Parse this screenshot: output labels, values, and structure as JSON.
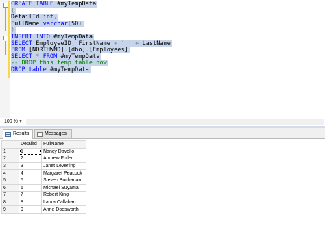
{
  "editor": {
    "lines": [
      [
        {
          "c": "kw",
          "t": "CREATE TABLE "
        },
        {
          "c": "tx",
          "t": "#myTempData"
        }
      ],
      [
        {
          "c": "gr",
          "t": "("
        }
      ],
      [
        {
          "c": "tx",
          "t": "DetailId "
        },
        {
          "c": "kw",
          "t": "int"
        },
        {
          "c": "gr",
          "t": ","
        }
      ],
      [
        {
          "c": "tx",
          "t": "FullName "
        },
        {
          "c": "kw",
          "t": "varchar"
        },
        {
          "c": "gr",
          "t": "("
        },
        {
          "c": "tx",
          "t": "50"
        },
        {
          "c": "gr",
          "t": ")"
        }
      ],
      [
        {
          "c": "gr",
          "t": ")"
        }
      ],
      [
        {
          "c": "kw",
          "t": "INSERT INTO "
        },
        {
          "c": "tx",
          "t": "#myTempData"
        }
      ],
      [
        {
          "c": "kw",
          "t": "SELECT "
        },
        {
          "c": "tx",
          "t": "EmployeeID"
        },
        {
          "c": "gr",
          "t": ", "
        },
        {
          "c": "tx",
          "t": "FirstName "
        },
        {
          "c": "gr",
          "t": "+ "
        },
        {
          "c": "st",
          "t": "' '"
        },
        {
          "c": "gr",
          "t": " + "
        },
        {
          "c": "tx",
          "t": "LastName"
        }
      ],
      [
        {
          "c": "kw",
          "t": "FROM "
        },
        {
          "c": "tx",
          "t": "[NORTHWND]"
        },
        {
          "c": "gr",
          "t": "."
        },
        {
          "c": "tx",
          "t": "[dbo]"
        },
        {
          "c": "gr",
          "t": "."
        },
        {
          "c": "tx",
          "t": "[Employees]"
        }
      ],
      [
        {
          "c": "kw",
          "t": "SELECT "
        },
        {
          "c": "gr",
          "t": "* "
        },
        {
          "c": "kw",
          "t": "FROM "
        },
        {
          "c": "tx",
          "t": "#myTempData"
        }
      ],
      [
        {
          "c": "cm",
          "t": "-- DROP this temp table now"
        }
      ],
      [
        {
          "c": "kw",
          "t": "DROP table "
        },
        {
          "c": "tx",
          "t": "#myTempData"
        }
      ]
    ]
  },
  "zoom": {
    "value": "100 %"
  },
  "tabs": {
    "results": "Results",
    "messages": "Messages"
  },
  "grid": {
    "columns": [
      "DetailId",
      "FullName"
    ],
    "rows": [
      [
        "1",
        "1",
        "Nancy Davolio"
      ],
      [
        "2",
        "2",
        "Andrew Fuller"
      ],
      [
        "3",
        "3",
        "Janet Leverling"
      ],
      [
        "4",
        "4",
        "Margaret Peacock"
      ],
      [
        "5",
        "5",
        "Steven Buchanan"
      ],
      [
        "6",
        "6",
        "Michael Suyama"
      ],
      [
        "7",
        "7",
        "Robert King"
      ],
      [
        "8",
        "8",
        "Laura Callahan"
      ],
      [
        "9",
        "9",
        "Anne Dodsworth"
      ]
    ]
  }
}
